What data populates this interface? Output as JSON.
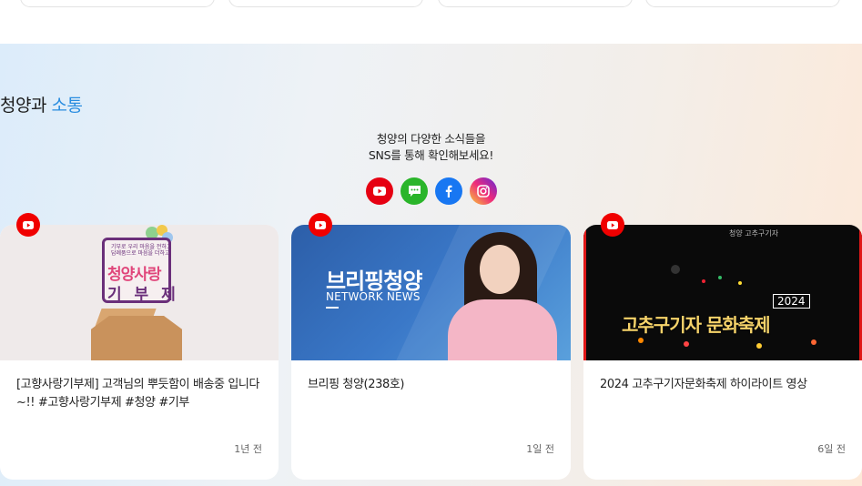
{
  "section": {
    "title_main": "청양과 ",
    "title_accent": "소통",
    "intro_line1": "청양의 다양한 소식들을",
    "intro_line2": "SNS를 통해 확인해보세요!"
  },
  "sns": [
    {
      "name": "youtube",
      "icon": "youtube-icon",
      "color": "#e60012"
    },
    {
      "name": "kakao-story",
      "icon": "chat-icon",
      "color": "#2ab52a"
    },
    {
      "name": "facebook",
      "icon": "facebook-icon",
      "color": "#1877f2"
    },
    {
      "name": "instagram",
      "icon": "instagram-icon",
      "color": "#d62976"
    }
  ],
  "cards": [
    {
      "title": "[고향사랑기부제] 고객님의 뿌듯함이 배송중 입니다~!! #고향사랑기부제 #청양 #기부",
      "time": "1년 전",
      "thumb": {
        "small_text": "기부로 우리 마음을 전하고\n답례품으로 마음을 더하고",
        "heading": "청양사랑",
        "sub": "기 부 제"
      }
    },
    {
      "title": "브리핑 청양(238호)",
      "time": "1일 전",
      "thumb": {
        "heading": "브리핑청양",
        "sub": "NETWORK NEWS"
      }
    },
    {
      "title": "2024 고추구기자문화축제 하이라이트 영상",
      "time": "6일 전",
      "thumb": {
        "year": "2024",
        "heading": "고추구기자 문화축제",
        "logo": "청양 고추구기자"
      }
    }
  ],
  "colors": {
    "accent": "#2a8de0",
    "youtube_red": "#f00000"
  }
}
